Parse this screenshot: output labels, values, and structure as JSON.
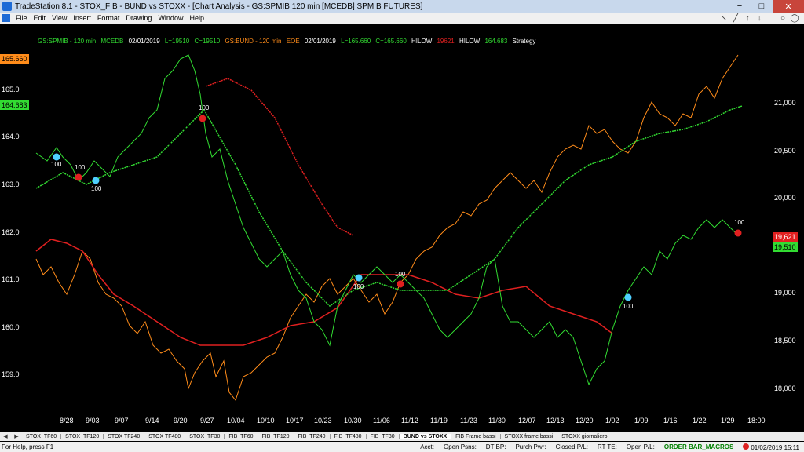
{
  "window": {
    "title": "TradeStation 8.1 - STOX_FIB - BUND vs STOXX - [Chart Analysis - GS:SPMIB 120 min [MCEDB] SPMIB FUTURES]",
    "minimize": "−",
    "maximize": "□",
    "close": "✕"
  },
  "menu": [
    "File",
    "Edit",
    "View",
    "Insert",
    "Format",
    "Drawing",
    "Window",
    "Help"
  ],
  "toolbar_icons": [
    "pointer-icon",
    "pen-icon",
    "arrow-up-icon",
    "arrow-down-icon",
    "square-icon",
    "circle-icon",
    "ellipse-icon"
  ],
  "toolbar_glyphs": [
    "↖",
    "╱",
    "↑",
    "↓",
    "□",
    "○",
    "◯"
  ],
  "legend": {
    "s1_symbol": "GS:SPMIB - 120 min",
    "s1_exch": "MCEDB",
    "s1_date": "02/01/2019",
    "s1_l": "L=19510",
    "s1_c": "C=19510",
    "s2_symbol": "GS:BUND - 120 min",
    "s2_exch": "EOE",
    "s2_date": "02/01/2019",
    "s2_l": "L=165.660",
    "s2_c": "C=165.660",
    "hl1": "HILOW",
    "hl1_val": "19621",
    "hl2": "HILOW",
    "hl2_val": "164.683",
    "strategy": "Strategy",
    "colors": {
      "spmib": "#32dc32",
      "bund": "#ff8c1a",
      "red": "#e02020",
      "white": "#ffffff"
    }
  },
  "y_left": {
    "ticks": [
      "165.0",
      "164.0",
      "163.0",
      "162.0",
      "161.0",
      "160.0",
      "159.0"
    ],
    "badge_top": "165.660",
    "badge_mid": "164.683"
  },
  "y_right": {
    "ticks": [
      "21,000",
      "20,500",
      "20,000",
      "19,500",
      "19,000",
      "18,500",
      "18,000"
    ],
    "badge_red": "19,621",
    "badge_green": "19,510"
  },
  "x_axis": [
    "8/28",
    "9/03",
    "9/07",
    "9/14",
    "9/20",
    "9/27",
    "10/04",
    "10/10",
    "10/17",
    "10/23",
    "10/30",
    "11/06",
    "11/12",
    "11/19",
    "11/23",
    "11/30",
    "12/07",
    "12/13",
    "12/20",
    "1/02",
    "1/09",
    "1/16",
    "1/22",
    "1/29",
    "18:00"
  ],
  "trade_labels": [
    "100",
    "100",
    "100",
    "100",
    "100",
    "100",
    "100",
    "100"
  ],
  "tabs": {
    "items": [
      "STOX_TF60",
      "STOX_TF120",
      "STOX TF240",
      "STOX TF480",
      "STOX_TF30",
      "FIB_TF60",
      "FIB_TF120",
      "FIB_TF240",
      "FIB_TF480",
      "FIB_TF30",
      "BUND vs STOXX",
      "FIB Frame bassi",
      "STOXX frame bassi",
      "STOXX giornaliero"
    ],
    "active_index": 10
  },
  "status": {
    "help": "For Help, press F1",
    "acct": "Acct:",
    "open_psns": "Open Psns:",
    "dt_bp": "DT BP:",
    "purch_pwr": "Purch Pwr:",
    "closed_pl": "Closed P/L:",
    "rt_te": "RT TE:",
    "open_pl": "Open P/L:",
    "macros": "ORDER BAR_MACROS",
    "datetime": "01/02/2019 15:11"
  }
}
